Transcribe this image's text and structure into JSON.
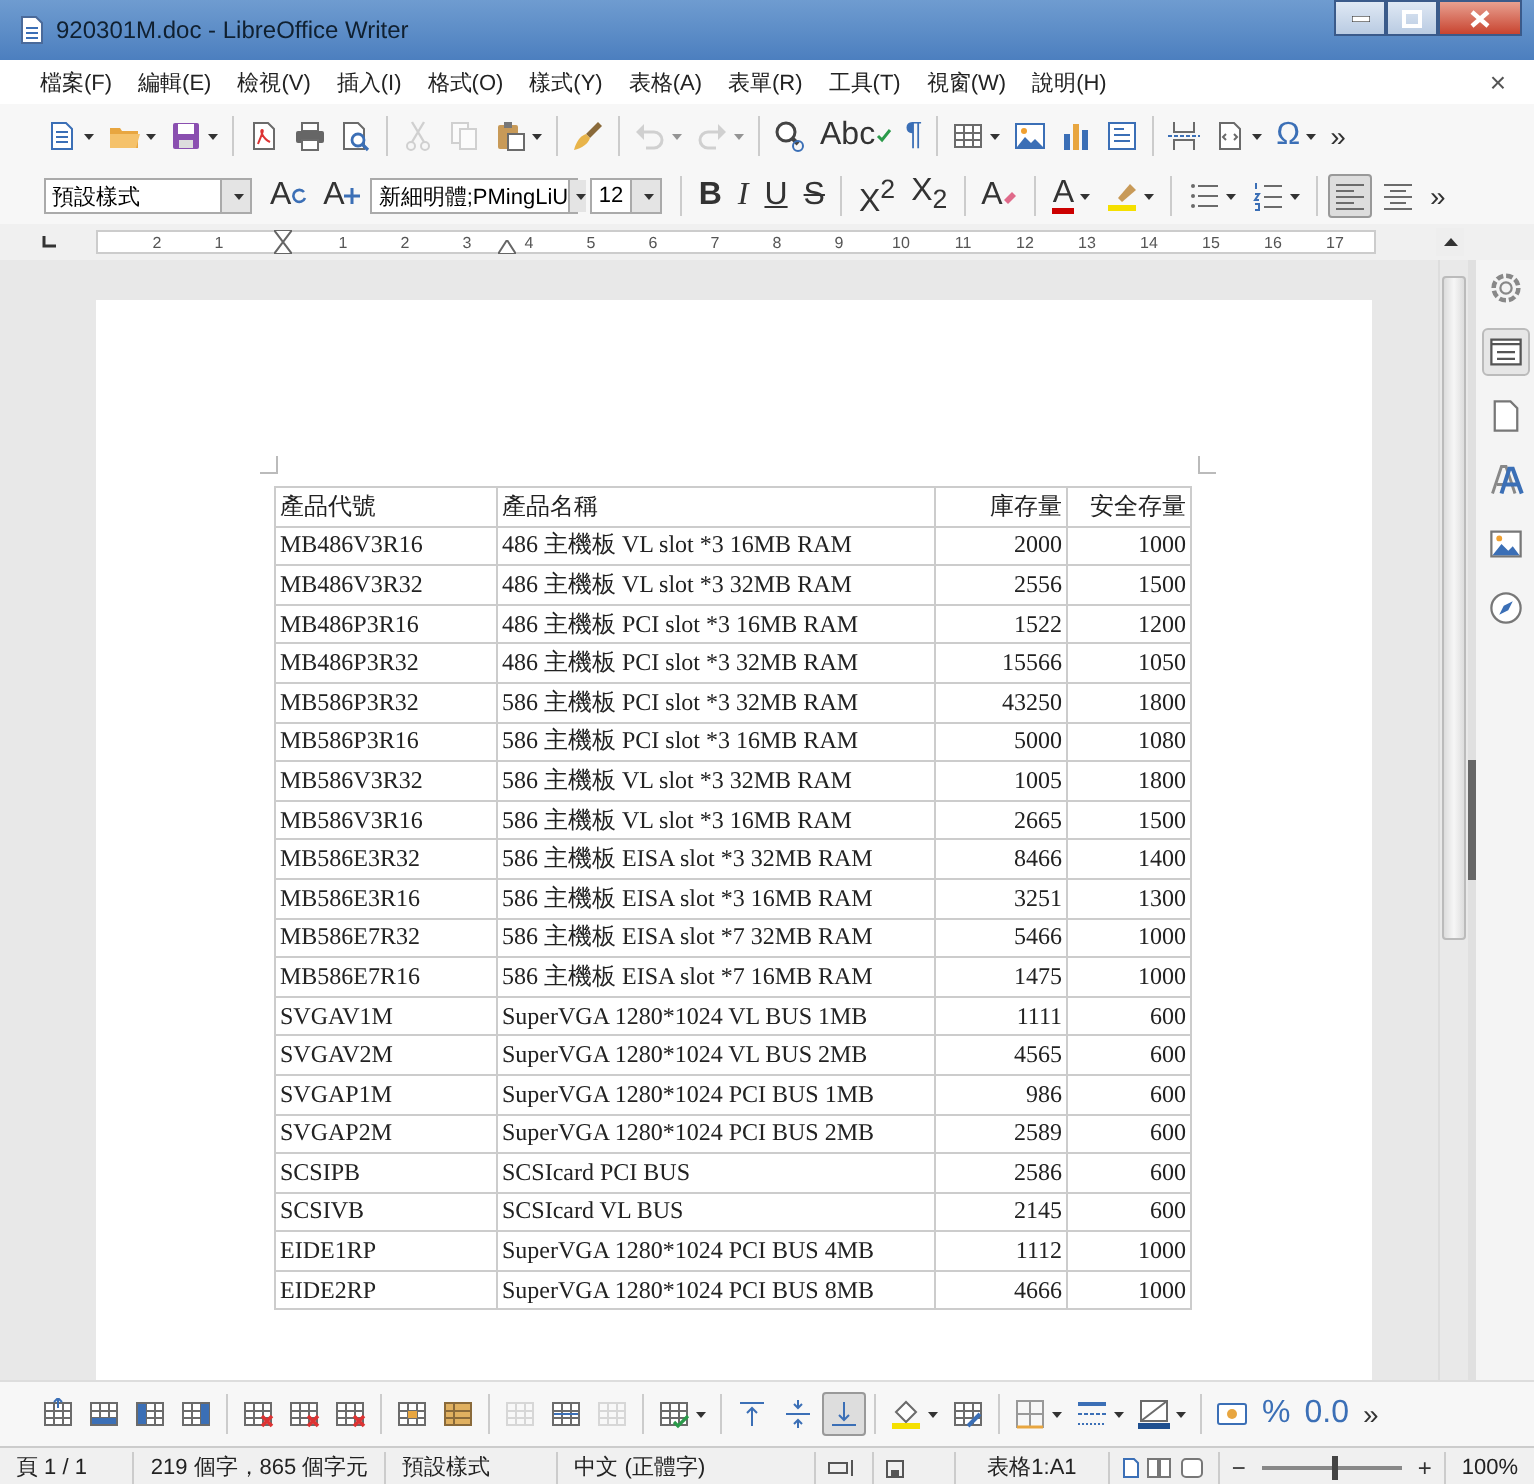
{
  "window": {
    "title": "920301M.doc - LibreOffice Writer"
  },
  "menu": [
    "檔案(F)",
    "編輯(E)",
    "檢視(V)",
    "插入(I)",
    "格式(O)",
    "樣式(Y)",
    "表格(A)",
    "表單(R)",
    "工具(T)",
    "視窗(W)",
    "說明(H)"
  ],
  "menu_close": "×",
  "standard_toolbar": [
    {
      "kind": "new-doc",
      "dropdown": true
    },
    {
      "kind": "open",
      "dropdown": true
    },
    {
      "kind": "save",
      "dropdown": true
    },
    {
      "kind": "separator"
    },
    {
      "kind": "export-pdf"
    },
    {
      "kind": "print"
    },
    {
      "kind": "preview"
    },
    {
      "kind": "separator"
    },
    {
      "kind": "cut",
      "disabled": true
    },
    {
      "kind": "copy",
      "disabled": true
    },
    {
      "kind": "paste",
      "dropdown": true
    },
    {
      "kind": "separator"
    },
    {
      "kind": "clone"
    },
    {
      "kind": "separator"
    },
    {
      "kind": "undo",
      "dropdown": true,
      "disabled": true
    },
    {
      "kind": "redo",
      "dropdown": true,
      "disabled": true
    },
    {
      "kind": "separator"
    },
    {
      "kind": "find"
    },
    {
      "kind": "spellcheck",
      "label": "Abc"
    },
    {
      "kind": "glyph",
      "label": "¶"
    },
    {
      "kind": "separator"
    },
    {
      "kind": "table",
      "dropdown": true
    },
    {
      "kind": "image"
    },
    {
      "kind": "chart"
    },
    {
      "kind": "textbox"
    },
    {
      "kind": "separator"
    },
    {
      "kind": "page-break"
    },
    {
      "kind": "field",
      "dropdown": true
    },
    {
      "kind": "glyph",
      "label": "Ω",
      "dropdown": true
    },
    {
      "kind": "more",
      "label": "»"
    }
  ],
  "formatting_toolbar": [
    {
      "kind": "style-combo",
      "value": "預設樣式"
    },
    {
      "kind": "style-update",
      "label": "A"
    },
    {
      "kind": "style-new",
      "label": "A"
    },
    {
      "kind": "font-combo",
      "value": "新細明體;PMingLiU"
    },
    {
      "kind": "size-combo",
      "value": "12"
    },
    {
      "kind": "separator"
    },
    {
      "kind": "bold",
      "label": "B"
    },
    {
      "kind": "italic",
      "label": "I"
    },
    {
      "kind": "underline",
      "label": "U"
    },
    {
      "kind": "strike",
      "label": "S"
    },
    {
      "kind": "separator"
    },
    {
      "kind": "script",
      "label": "X$^{2}$"
    },
    {
      "kind": "script",
      "label": "X$_{2}$"
    },
    {
      "kind": "separator"
    },
    {
      "kind": "clear-format",
      "label": "A"
    },
    {
      "kind": "separator"
    },
    {
      "kind": "font-color",
      "label": "A",
      "dropdown": true
    },
    {
      "kind": "highlight",
      "dropdown": true
    },
    {
      "kind": "separator"
    },
    {
      "kind": "bullets",
      "dropdown": true
    },
    {
      "kind": "numbering",
      "dropdown": true
    },
    {
      "kind": "separator"
    },
    {
      "kind": "align-left",
      "on": true
    },
    {
      "kind": "align-center",
      "on": false
    },
    {
      "kind": "more",
      "label": "»"
    }
  ],
  "ruler": {
    "left_labels": [
      "2",
      "1"
    ],
    "right_labels": [
      "1",
      "2",
      "3",
      "4",
      "5",
      "6",
      "7",
      "8",
      "9",
      "10",
      "11",
      "12",
      "13",
      "14",
      "15",
      "16",
      "17"
    ]
  },
  "table": {
    "columns": [
      "產品代號",
      "產品名稱",
      "庫存量",
      "安全存量"
    ],
    "rows": [
      [
        "MB486V3R16",
        "486 主機板 VL slot *3 16MB RAM",
        "2000",
        "1000"
      ],
      [
        "MB486V3R32",
        "486 主機板 VL slot *3 32MB RAM",
        "2556",
        "1500"
      ],
      [
        "MB486P3R16",
        "486 主機板 PCI slot *3 16MB RAM",
        "1522",
        "1200"
      ],
      [
        "MB486P3R32",
        "486 主機板 PCI slot *3 32MB RAM",
        "15566",
        "1050"
      ],
      [
        "MB586P3R32",
        "586 主機板 PCI slot *3 32MB RAM",
        "43250",
        "1800"
      ],
      [
        "MB586P3R16",
        "586 主機板 PCI slot *3 16MB RAM",
        "5000",
        "1080"
      ],
      [
        "MB586V3R32",
        "586 主機板 VL slot *3 32MB RAM",
        "1005",
        "1800"
      ],
      [
        "MB586V3R16",
        "586 主機板 VL slot *3 16MB RAM",
        "2665",
        "1500"
      ],
      [
        "MB586E3R32",
        "586 主機板 EISA slot *3 32MB RAM",
        "8466",
        "1400"
      ],
      [
        "MB586E3R16",
        "586 主機板 EISA slot *3 16MB RAM",
        "3251",
        "1300"
      ],
      [
        "MB586E7R32",
        "586 主機板 EISA slot *7 32MB RAM",
        "5466",
        "1000"
      ],
      [
        "MB586E7R16",
        "586 主機板 EISA slot *7 16MB RAM",
        "1475",
        "1000"
      ],
      [
        "SVGAV1M",
        "SuperVGA 1280*1024 VL BUS 1MB",
        "1111",
        "600"
      ],
      [
        "SVGAV2M",
        "SuperVGA 1280*1024 VL BUS 2MB",
        "4565",
        "600"
      ],
      [
        "SVGAP1M",
        "SuperVGA 1280*1024 PCI BUS 1MB",
        "986",
        "600"
      ],
      [
        "SVGAP2M",
        "SuperVGA 1280*1024 PCI BUS 2MB",
        "2589",
        "600"
      ],
      [
        "SCSIPB",
        "SCSIcard PCI BUS",
        "2586",
        "600"
      ],
      [
        "SCSIVB",
        "SCSIcard VL BUS",
        "2145",
        "600"
      ],
      [
        "EIDE1RP",
        "SuperVGA 1280*1024 PCI BUS 4MB",
        "1112",
        "1000"
      ],
      [
        "EIDE2RP",
        "SuperVGA 1280*1024 PCI BUS 8MB",
        "4666",
        "1000"
      ]
    ]
  },
  "sidebar": [
    {
      "kind": "settings",
      "selected": false
    },
    {
      "kind": "properties",
      "selected": true
    },
    {
      "kind": "page",
      "selected": false
    },
    {
      "kind": "styles",
      "selected": false
    },
    {
      "kind": "gallery",
      "selected": false
    },
    {
      "kind": "navigator",
      "selected": false
    }
  ],
  "table_toolbar": [
    {
      "kind": "row-above"
    },
    {
      "kind": "row-below"
    },
    {
      "kind": "col-before"
    },
    {
      "kind": "col-after"
    },
    {
      "kind": "separator"
    },
    {
      "kind": "delete-rows"
    },
    {
      "kind": "delete-cols"
    },
    {
      "kind": "delete-table"
    },
    {
      "kind": "separator"
    },
    {
      "kind": "select-cell"
    },
    {
      "kind": "select-table"
    },
    {
      "kind": "separator"
    },
    {
      "kind": "merge",
      "disabled": true
    },
    {
      "kind": "split"
    },
    {
      "kind": "split-table",
      "disabled": true
    },
    {
      "kind": "separator"
    },
    {
      "kind": "autoformat",
      "dropdown": true
    },
    {
      "kind": "separator"
    },
    {
      "kind": "valign-top"
    },
    {
      "kind": "valign-center"
    },
    {
      "kind": "valign-bottom",
      "on": true
    },
    {
      "kind": "separator"
    },
    {
      "kind": "bg-color",
      "dropdown": true
    },
    {
      "kind": "table-props"
    },
    {
      "kind": "separator"
    },
    {
      "kind": "borders",
      "dropdown": true
    },
    {
      "kind": "border-style",
      "dropdown": true
    },
    {
      "kind": "border-color",
      "dropdown": true
    },
    {
      "kind": "separator"
    },
    {
      "kind": "number-format"
    },
    {
      "kind": "glyph",
      "label": "%"
    },
    {
      "kind": "glyph",
      "label": "0.0"
    },
    {
      "kind": "more",
      "label": "»"
    }
  ],
  "status_bar": {
    "page": "頁 1 / 1",
    "words": "219 個字，865 個字元",
    "page_style": "預設樣式",
    "language": "中文 (正體字)",
    "table_cell": "表格1:A1",
    "zoom": {
      "out": "−",
      "level": 0.5,
      "in": "+",
      "reading": "100%"
    }
  }
}
